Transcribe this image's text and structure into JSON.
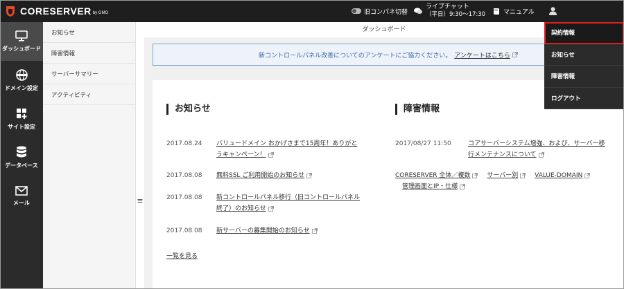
{
  "header": {
    "logo_text": "CORESERVER",
    "logo_sub": "by GMO",
    "old_panel_toggle": "旧コンパネ切替",
    "live_chat_title": "ライブチャット",
    "live_chat_hours": "（平日）9:30〜17:30",
    "manual": "マニュアル"
  },
  "leftnav": {
    "items": [
      {
        "label": "ダッシュボード",
        "icon": "monitor-icon"
      },
      {
        "label": "ドメイン設定",
        "icon": "globe-icon"
      },
      {
        "label": "サイト設定",
        "icon": "grid-plus-icon"
      },
      {
        "label": "データベース",
        "icon": "database-icon"
      },
      {
        "label": "メール",
        "icon": "mail-icon"
      }
    ]
  },
  "submenu": {
    "items": [
      "お知らせ",
      "障害情報",
      "サーバーサマリー",
      "アクティビティ"
    ]
  },
  "page": {
    "title": "ダッシュボード",
    "survey_text": "新コントロールパネル改善についてのアンケートにご協力ください。",
    "survey_link": "アンケートはこちら"
  },
  "news": {
    "title": "お知らせ",
    "items": [
      {
        "date": "2017.08.24",
        "text": "バリュードメイン おかげさまで15周年！ありがとうキャンペーン！"
      },
      {
        "date": "2017.08.08",
        "text": "無料SSL ご利用開始のお知らせ"
      },
      {
        "date": "2017.08.08",
        "text": "新コントロールパネル移行（旧コントロールパネル終了）のお知らせ"
      },
      {
        "date": "2017.08.08",
        "text": "新サーバーの募集開始のお知らせ"
      }
    ],
    "more": "一覧を見る"
  },
  "failures": {
    "title": "障害情報",
    "items": [
      {
        "date": "2017/08/27 11:50",
        "text": "コアサーバーシステム増強、および、サーバー移行メンテナンスについて"
      }
    ],
    "links": [
      "CORESERVER 全体／複数",
      "サーバー別",
      "VALUE-DOMAIN",
      "管理画面とIP・仕様"
    ]
  },
  "dropdown": {
    "items": [
      "契約情報",
      "お知らせ",
      "障害情報",
      "ログアウト"
    ]
  },
  "colors": {
    "topbar": "#1e1e1e",
    "sidebar": "#2b2b2b",
    "logo_red": "#e8472b",
    "highlight": "#e02020"
  }
}
